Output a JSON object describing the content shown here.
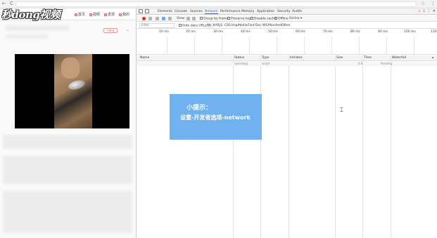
{
  "browser": {
    "back": "←",
    "reload": "C",
    "star": "☆",
    "menu": "⋮"
  },
  "page": {
    "logo": "秒dong视频",
    "nav": [
      "首页",
      "视频",
      "发现",
      "我的"
    ],
    "follow_label": "+关注"
  },
  "devtools": {
    "tabs": [
      "Elements",
      "Console",
      "Sources",
      "Network",
      "Performance",
      "Memory",
      "Application",
      "Security",
      "Audits"
    ],
    "active_tab": "Network",
    "warning_count": "1",
    "toolbar": {
      "view_label": "View:",
      "group_label": "Group by frame",
      "preserve_label": "Preserve log",
      "disable_cache_label": "Disable cache",
      "offline_label": "Offline",
      "throttle_label": "Online"
    },
    "filter": {
      "placeholder": "Filter",
      "hide_data_urls": "Hide data URLs",
      "types": [
        "All",
        "XHR",
        "JS",
        "CSS",
        "Img",
        "Media",
        "Font",
        "Doc",
        "WS",
        "Manifest",
        "Other"
      ]
    },
    "timeline_ticks": [
      "10 ms",
      "20 ms",
      "30 ms",
      "40 ms",
      "50 ms",
      "60 ms",
      "70 ms",
      "80 ms",
      "90 ms",
      "100 ms",
      "110"
    ],
    "columns": [
      "Name",
      "Status",
      "Type",
      "Initiator",
      "Size",
      "Time",
      "Waterfall"
    ],
    "rows": [
      {
        "name": "",
        "status": "(pending)",
        "type": "script",
        "initiator": "",
        "size": "0 B",
        "time": "Pending"
      }
    ]
  },
  "tip": {
    "title": "小提示：",
    "text": "设置-开发者选项-network"
  },
  "colors": {
    "tip_bg": "#6fb2ef",
    "accent": "#1a73e8",
    "record": "#d93025"
  }
}
